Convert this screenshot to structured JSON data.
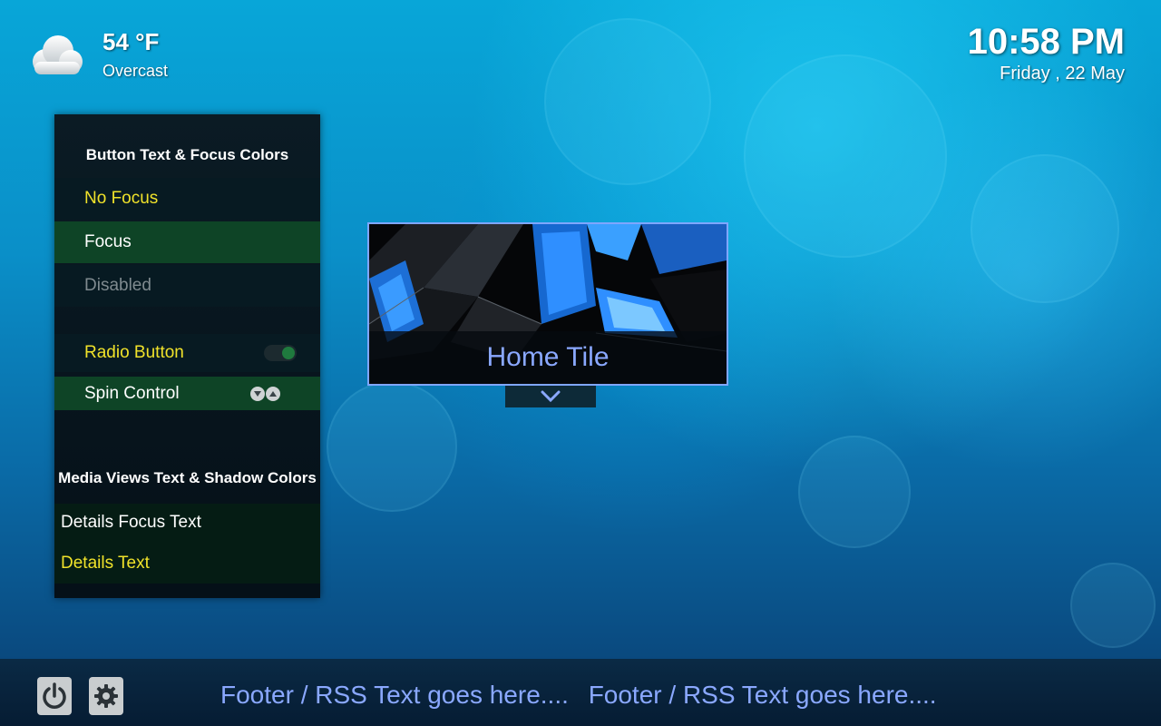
{
  "weather": {
    "temperature": "54 °F",
    "condition": "Overcast",
    "icon": "cloud-icon"
  },
  "clock": {
    "time": "10:58 PM",
    "date": "Friday , 22 May"
  },
  "panel": {
    "button_heading": "Button Text & Focus Colors",
    "rows": [
      {
        "label": "No Focus"
      },
      {
        "label": "Focus"
      },
      {
        "label": "Disabled"
      },
      {
        "label": "Radio Button"
      },
      {
        "label": "Spin Control"
      }
    ],
    "media_heading": "Media Views Text & Shadow Colors",
    "media_rows": [
      {
        "label": "Details Focus Text"
      },
      {
        "label": "Details Text"
      }
    ]
  },
  "home_tile": {
    "label": "Home Tile"
  },
  "footer": {
    "rss_items": [
      "Footer / RSS Text goes here....",
      "Footer / RSS Text goes here...."
    ],
    "power_icon": "power-icon",
    "settings_icon": "gear-icon"
  },
  "colors": {
    "accent_blue": "#8aa8ff",
    "yellow_text": "#f0e22a",
    "focus_green": "#0e4426",
    "disabled_grey": "#7f8a8f"
  }
}
